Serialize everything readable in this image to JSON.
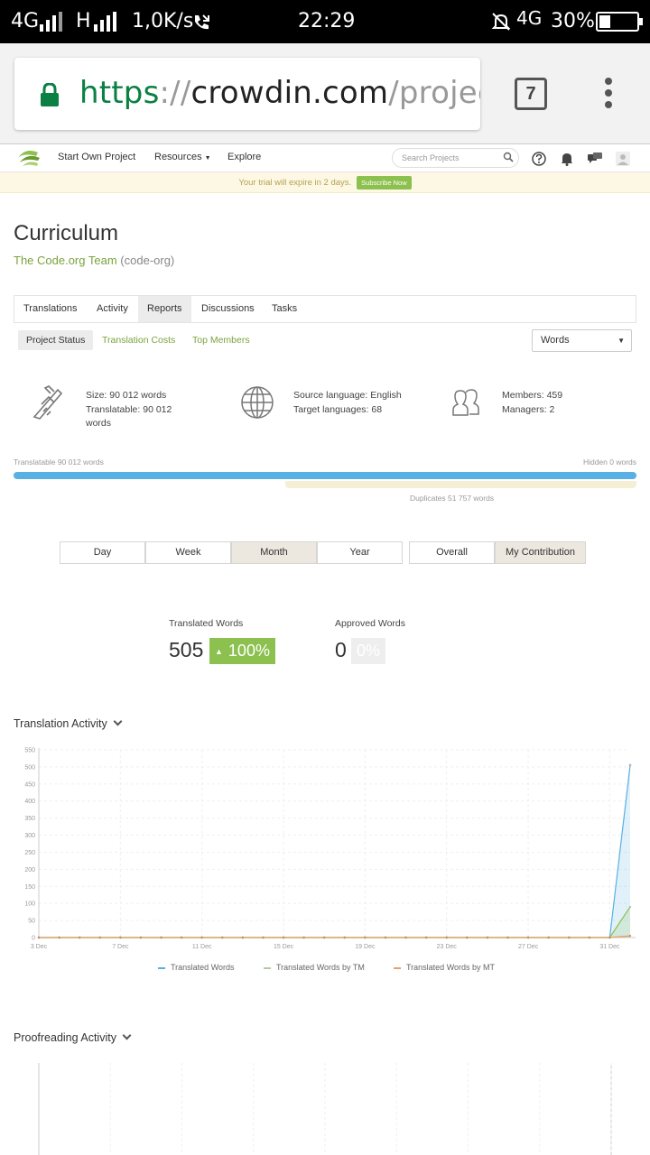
{
  "status_bar": {
    "net1": "4G",
    "net2": "H",
    "speed": "1,0K/s",
    "time": "22:29",
    "net3": "4G",
    "battery": "30%"
  },
  "browser": {
    "url_scheme": "https",
    "url_sep": "://",
    "url_host": "crowdin.com",
    "url_path": "/project/le",
    "tab_count": "7"
  },
  "header": {
    "nav": [
      "Start Own Project",
      "Resources",
      "Explore"
    ],
    "search_placeholder": "Search Projects",
    "trial_text": "Your trial will expire in 2 days.",
    "subscribe_label": "Subscribe Now"
  },
  "project": {
    "title": "Curriculum",
    "team": "The Code.org Team",
    "slug": "(code-org)"
  },
  "tabs": [
    "Translations",
    "Activity",
    "Reports",
    "Discussions",
    "Tasks"
  ],
  "active_tab": "Reports",
  "subtabs": [
    "Project Status",
    "Translation Costs",
    "Top Members"
  ],
  "unit_select": "Words",
  "stats": {
    "size": "Size: 90 012 words",
    "translatable1": "Translatable: 90 012",
    "translatable2": "words",
    "source": "Source language: English",
    "target": "Target languages: 68",
    "members": "Members: 459",
    "managers": "Managers: 2"
  },
  "progress": {
    "translatable_label": "Translatable 90 012 words",
    "hidden_label": "Hidden 0 words",
    "duplicates_label": "Duplicates 51 757 words",
    "translatable_words": 90012,
    "duplicates_words": 51757
  },
  "periods": [
    "Day",
    "Week",
    "Month",
    "Year"
  ],
  "active_period": "Month",
  "scopes": [
    "Overall",
    "My Contribution"
  ],
  "active_scope": "My Contribution",
  "counters": {
    "translated_label": "Translated Words",
    "translated_value": "505",
    "translated_pct": "100%",
    "approved_label": "Approved Words",
    "approved_value": "0",
    "approved_pct": "0%"
  },
  "sections": {
    "translation_activity": "Translation Activity",
    "proofreading_activity": "Proofreading Activity"
  },
  "colors": {
    "accent_green": "#8cc04f",
    "link_green": "#7aa33c",
    "progress_blue": "#5aafe3",
    "series_translated": "#5aafe3",
    "series_tm": "#8cc04f",
    "series_mt": "#e8a068"
  },
  "chart_data": {
    "type": "line",
    "x_ticks": [
      "3 Dec",
      "7 Dec",
      "11 Dec",
      "15 Dec",
      "19 Dec",
      "23 Dec",
      "27 Dec",
      "31 Dec"
    ],
    "y_ticks": [
      "0",
      "50",
      "100",
      "150",
      "200",
      "250",
      "300",
      "350",
      "400",
      "450",
      "500",
      "550"
    ],
    "ylim": [
      0,
      550
    ],
    "x": [
      "3 Dec",
      "4 Dec",
      "5 Dec",
      "6 Dec",
      "7 Dec",
      "8 Dec",
      "9 Dec",
      "10 Dec",
      "11 Dec",
      "12 Dec",
      "13 Dec",
      "14 Dec",
      "15 Dec",
      "16 Dec",
      "17 Dec",
      "18 Dec",
      "19 Dec",
      "20 Dec",
      "21 Dec",
      "22 Dec",
      "23 Dec",
      "24 Dec",
      "25 Dec",
      "26 Dec",
      "27 Dec",
      "28 Dec",
      "29 Dec",
      "30 Dec",
      "31 Dec",
      "1 Jan"
    ],
    "series": [
      {
        "name": "Translated Words",
        "values": [
          0,
          0,
          0,
          0,
          0,
          0,
          0,
          0,
          0,
          0,
          0,
          0,
          0,
          0,
          0,
          0,
          0,
          0,
          0,
          0,
          0,
          0,
          0,
          0,
          0,
          0,
          0,
          0,
          0,
          505
        ]
      },
      {
        "name": "Translated Words by TM",
        "values": [
          0,
          0,
          0,
          0,
          0,
          0,
          0,
          0,
          0,
          0,
          0,
          0,
          0,
          0,
          0,
          0,
          0,
          0,
          0,
          0,
          0,
          0,
          0,
          0,
          0,
          0,
          0,
          0,
          0,
          90
        ]
      },
      {
        "name": "Translated Words by MT",
        "values": [
          0,
          0,
          0,
          0,
          0,
          0,
          0,
          0,
          0,
          0,
          0,
          0,
          0,
          0,
          0,
          0,
          0,
          0,
          0,
          0,
          0,
          0,
          0,
          0,
          0,
          0,
          0,
          0,
          0,
          5
        ]
      }
    ],
    "grid": true,
    "legend": "bottom"
  }
}
